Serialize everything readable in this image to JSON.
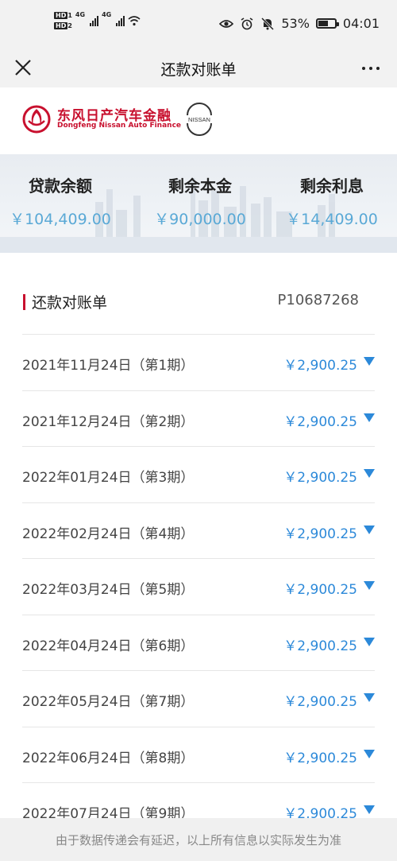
{
  "status_bar": {
    "hd1": "HD",
    "hd1_sub": "1",
    "hd2": "HD",
    "hd2_sub": "2",
    "net1": "4G",
    "net2": "4G",
    "battery_pct": "53%",
    "time": "04:01"
  },
  "header": {
    "title": "还款对账单"
  },
  "brand": {
    "name_cn": "东风日产汽车金融",
    "name_en": "Dongfeng Nissan Auto Finance",
    "nissan": "NISSAN"
  },
  "summary": [
    {
      "label": "贷款余额",
      "amount": "￥104,409.00"
    },
    {
      "label": "剩余本金",
      "amount": "￥90,000.00"
    },
    {
      "label": "剩余利息",
      "amount": "￥14,409.00"
    }
  ],
  "statement": {
    "title": "还款对账单",
    "id": "P10687268"
  },
  "installments": [
    {
      "date": "2021年11月24日（第1期）",
      "amount": "￥2,900.25"
    },
    {
      "date": "2021年12月24日（第2期）",
      "amount": "￥2,900.25"
    },
    {
      "date": "2022年01月24日（第3期）",
      "amount": "￥2,900.25"
    },
    {
      "date": "2022年02月24日（第4期）",
      "amount": "￥2,900.25"
    },
    {
      "date": "2022年03月24日（第5期）",
      "amount": "￥2,900.25"
    },
    {
      "date": "2022年04月24日（第6期）",
      "amount": "￥2,900.25"
    },
    {
      "date": "2022年05月24日（第7期）",
      "amount": "￥2,900.25"
    },
    {
      "date": "2022年06月24日（第8期）",
      "amount": "￥2,900.25"
    },
    {
      "date": "2022年07月24日（第9期）",
      "amount": "￥2,900.25"
    }
  ],
  "footer": {
    "note": "由于数据传递会有延迟，以上所有信息以实际发生为准"
  },
  "colors": {
    "brand_red": "#c8102e",
    "amount_blue": "#2c89d9",
    "summary_blue": "#5aa9d6"
  }
}
